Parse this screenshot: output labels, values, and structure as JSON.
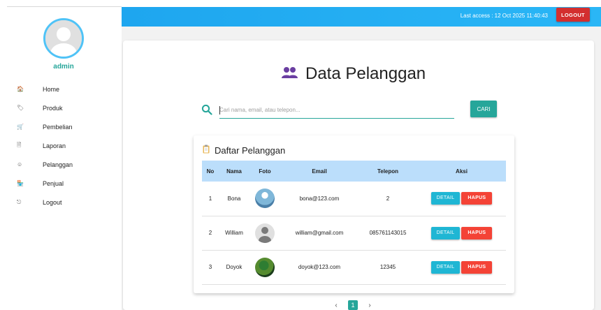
{
  "user": {
    "name": "admin"
  },
  "sidebar": {
    "items": [
      {
        "label": "Home",
        "icon": "home-icon",
        "glyph": "🏠"
      },
      {
        "label": "Produk",
        "icon": "tag-icon",
        "glyph": "🏷"
      },
      {
        "label": "Pembelian",
        "icon": "cart-icon",
        "glyph": "🛒"
      },
      {
        "label": "Laporan",
        "icon": "document-icon",
        "glyph": "🗎"
      },
      {
        "label": "Pelanggan",
        "icon": "face-icon",
        "glyph": "☺"
      },
      {
        "label": "Penjual",
        "icon": "store-icon",
        "glyph": "🏪"
      },
      {
        "label": "Logout",
        "icon": "exit-icon",
        "glyph": "⎋"
      }
    ]
  },
  "topbar": {
    "last_access": "Last access : 12 Oct 2025 11:40:43",
    "logout_label": "LOGOUT"
  },
  "page": {
    "title": "Data Pelanggan"
  },
  "search": {
    "placeholder": "Cari nama, email, atau telepon...",
    "value": "",
    "button_label": "CARI"
  },
  "table": {
    "heading": "Daftar Pelanggan",
    "columns": [
      "No",
      "Nama",
      "Foto",
      "Email",
      "Telepon",
      "Aksi"
    ],
    "rows": [
      {
        "no": "1",
        "nama": "Bona",
        "email": "bona@123.com",
        "telepon": "2"
      },
      {
        "no": "2",
        "nama": "William",
        "email": "william@gmail.com",
        "telepon": "085761143015"
      },
      {
        "no": "3",
        "nama": "Doyok",
        "email": "doyok@123.com",
        "telepon": "12345"
      }
    ],
    "detail_label": "DETAIL",
    "hapus_label": "HAPUS"
  },
  "pagination": {
    "prev": "‹",
    "current": "1",
    "next": "›"
  },
  "colors": {
    "accent": "#26a69a",
    "topbar": "#1ea6ef",
    "logout": "#d32f2f",
    "detail": "#1fb6d4",
    "hapus": "#f44336",
    "table_header": "#bbdefb"
  }
}
